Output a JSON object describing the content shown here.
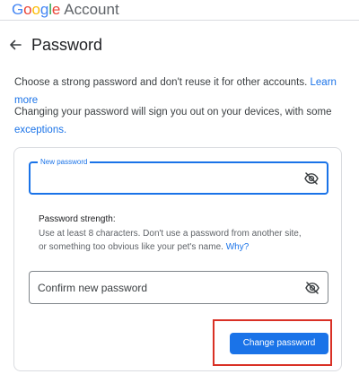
{
  "header": {
    "brand_letters": [
      "G",
      "o",
      "o",
      "g",
      "l",
      "e"
    ],
    "product": "Account"
  },
  "page": {
    "back_icon": "arrow-back-icon",
    "title": "Password"
  },
  "intro": {
    "text": "Choose a strong password and don't reuse it for other accounts.",
    "link": "Learn more"
  },
  "notice": {
    "text": "Changing your password will sign you out on your devices, with some",
    "link": "exceptions."
  },
  "form": {
    "new_password": {
      "label": "New password",
      "value": "",
      "visibility_icon": "eye-off-icon"
    },
    "strength": {
      "title": "Password strength:",
      "text": "Use at least 8 characters. Don't use a password from another site, or something too obvious like your pet's name.",
      "link": "Why?"
    },
    "confirm_password": {
      "placeholder": "Confirm new password",
      "value": "",
      "visibility_icon": "eye-off-icon"
    },
    "submit_label": "Change password"
  },
  "colors": {
    "accent": "#1a73e8",
    "highlight": "#d93025",
    "text": "#202124",
    "muted": "#5f6368"
  }
}
